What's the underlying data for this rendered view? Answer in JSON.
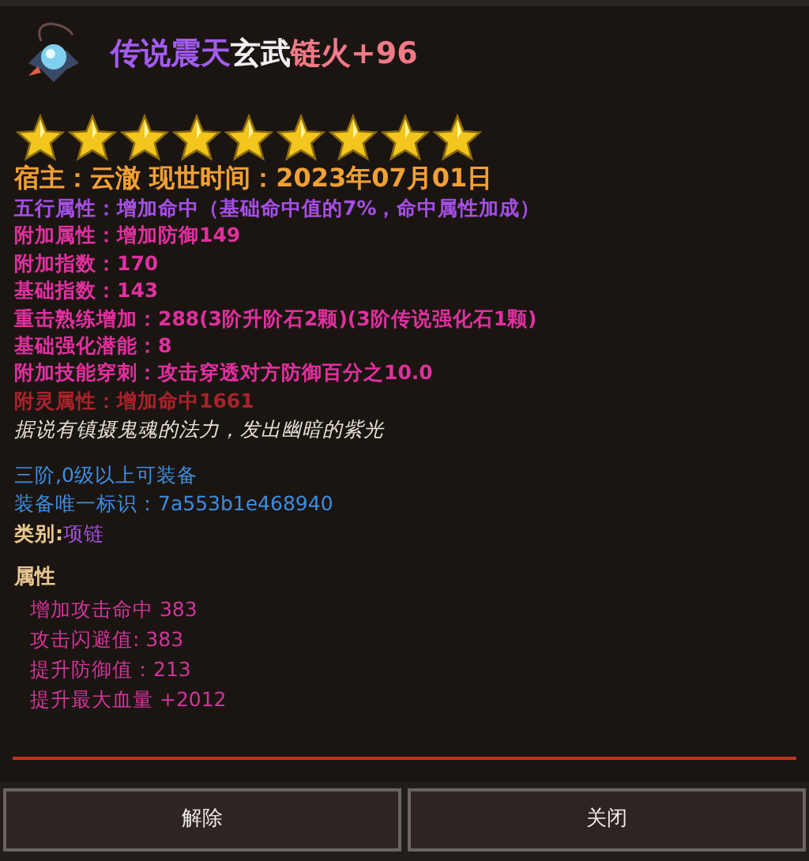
{
  "title": {
    "parts": [
      {
        "text": "传说震天",
        "color": "#a35cf0"
      },
      {
        "text": "玄武",
        "color": "#f2eef2"
      },
      {
        "text": "链火+96",
        "color": "#f07a86"
      }
    ]
  },
  "stars": 9,
  "owner_line": "宿主：云澈 现世时间：2023年07月01日",
  "attributes": [
    {
      "text": "五行属性：增加命中（基础命中值的7%，命中属性加成）",
      "color": "#a64fe6"
    },
    {
      "text": "附加属性：增加防御149",
      "color": "#e0309e"
    },
    {
      "text": "附加指数：170",
      "color": "#e0309e"
    },
    {
      "text": "基础指数：143",
      "color": "#e0309e"
    },
    {
      "text": "重击熟练增加：288(3阶升阶石2颗)(3阶传说强化石1颗)",
      "color": "#e0309e"
    },
    {
      "text": "基础强化潜能：8",
      "color": "#e0309e"
    },
    {
      "text": "附加技能穿刺：攻击穿透对方防御百分之10.0",
      "color": "#e0309e"
    },
    {
      "text": "附灵属性：增加命中1661",
      "color": "#a8232a"
    }
  ],
  "description": "据说有镇摄鬼魂的法力，发出幽暗的紫光",
  "requirement": "三阶,0级以上可装备",
  "unique_id": "装备唯一标识：7a553b1e468940",
  "category": {
    "label": "类别:",
    "value": "项链"
  },
  "properties_heading": "属性",
  "properties": [
    "增加攻击命中 383",
    "攻击闪避值: 383",
    "提升防御值：213",
    "提升最大血量 +2012"
  ],
  "buttons": [
    "解除",
    "关闭"
  ]
}
